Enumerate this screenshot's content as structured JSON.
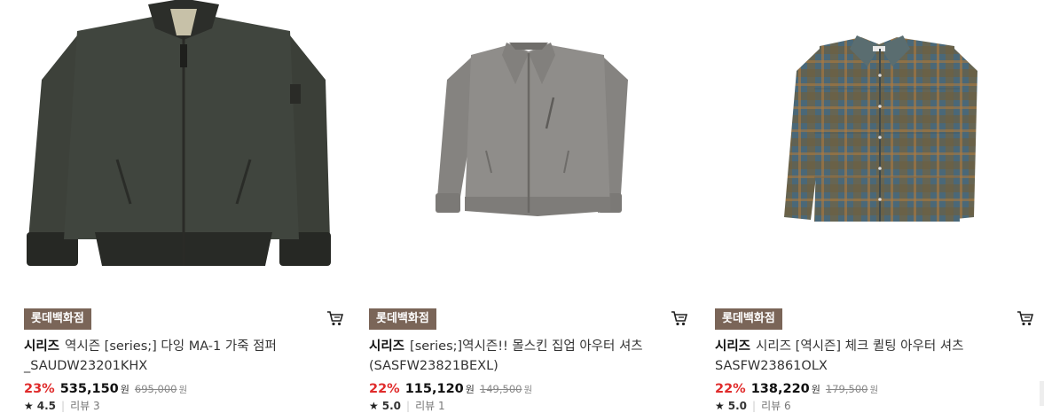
{
  "products": [
    {
      "store": "롯데백화점",
      "brand": "시리즈",
      "name_line1": "역시즌 [series;] 다잉 MA-1 가죽 점퍼",
      "name_line2": "_SAUDW23201KHX",
      "discount": "23%",
      "price": "535,150",
      "currency": "원",
      "original_price": "695,000",
      "rating": "4.5",
      "review_label": "리뷰 3",
      "image_icon": "bomber-jacket-image",
      "colors": {
        "body": "#3b3f39",
        "rib": "#2a2b28"
      }
    },
    {
      "store": "롯데백화점",
      "brand": "시리즈",
      "name_line1": "[series;]역시즌!! 몰스킨 집업 아우터 셔츠",
      "name_line2": "(SASFW23821BEXL)",
      "discount": "22%",
      "price": "115,120",
      "currency": "원",
      "original_price": "149,500",
      "rating": "5.0",
      "review_label": "리뷰 1",
      "image_icon": "zip-shirt-jacket-image",
      "colors": {
        "body": "#8c8a87",
        "rib": "#7a7875"
      }
    },
    {
      "store": "롯데백화점",
      "brand": "시리즈",
      "name_line1": "시리즈 [역시즌] 체크 퀼팅 아우터 셔츠",
      "name_line2": "SASFW23861OLX",
      "discount": "22%",
      "price": "138,220",
      "currency": "원",
      "original_price": "179,500",
      "rating": "5.0",
      "review_label": "리뷰 6",
      "image_icon": "check-quilted-shirt-image",
      "colors": {
        "body": "#4d6a7a",
        "rib": "#6b5a3c"
      }
    }
  ],
  "cart_icon": "cart-icon",
  "star_icon": "star-icon"
}
